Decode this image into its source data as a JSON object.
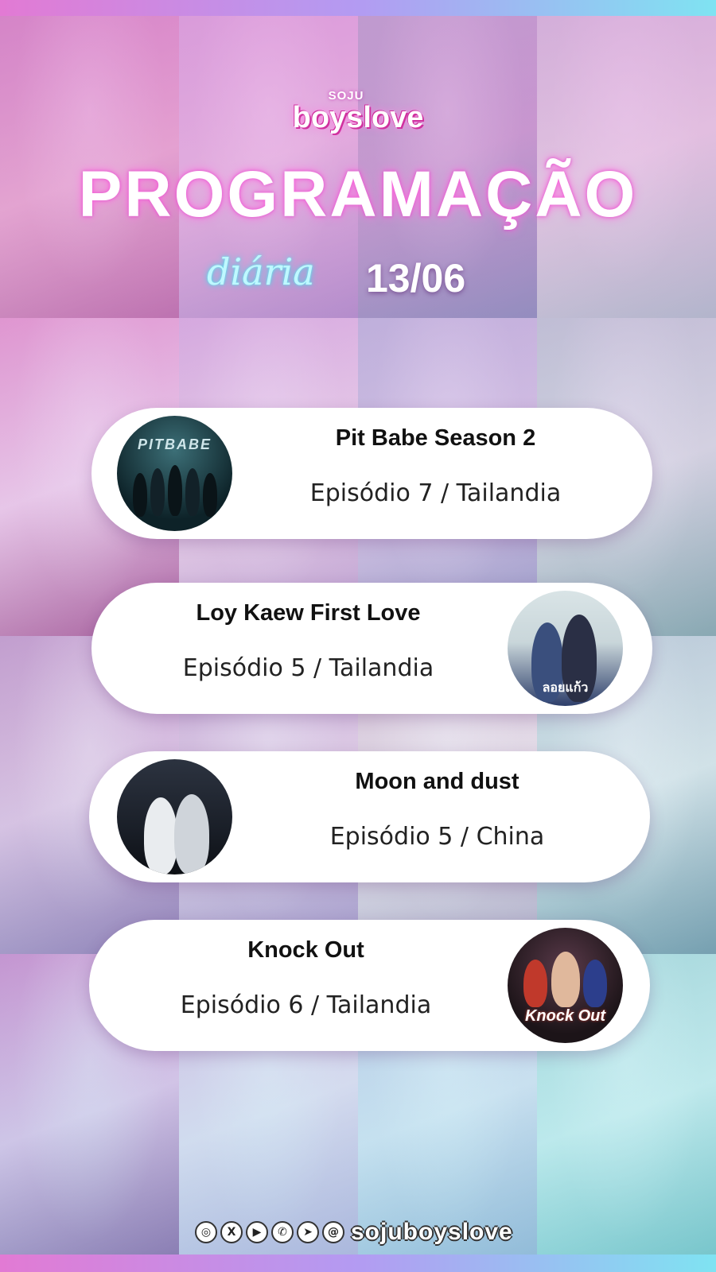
{
  "logo": {
    "prefix": "SOJU",
    "main": "boyslove"
  },
  "header": {
    "title": "PROGRAMAÇÃO",
    "script": "diária",
    "date": "13/06"
  },
  "cards": [
    {
      "title": "Pit Babe Season 2",
      "episode": "Episódio 7 / Tailandia",
      "poster_text": "PITBABE"
    },
    {
      "title": "Loy Kaew First Love",
      "episode": "Episódio 5 / Tailandia",
      "poster_text": "ลอยแก้ว"
    },
    {
      "title": "Moon and dust",
      "episode": "Episódio 5 / China",
      "poster_text": ""
    },
    {
      "title": "Knock Out",
      "episode": "Episódio 6 / Tailandia",
      "poster_text": "Knock Out"
    }
  ],
  "footer": {
    "icons": [
      "instagram-icon",
      "x-icon",
      "youtube-icon",
      "whatsapp-icon",
      "telegram-icon",
      "threads-icon"
    ],
    "handle": "sojuboyslove"
  },
  "colors": {
    "accent_pink": "#d0309f",
    "accent_cyan": "#38d8f0",
    "card_bg": "#ffffff"
  }
}
